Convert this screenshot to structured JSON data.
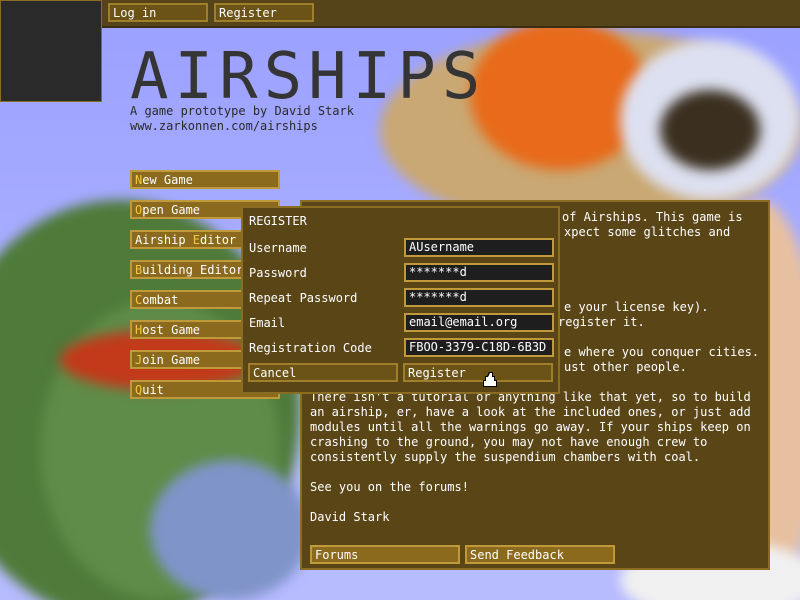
{
  "topbar": {
    "login": "Log in",
    "register": "Register"
  },
  "header": {
    "title": "AIRSHIPS",
    "subtitle": "A game prototype by David Stark",
    "url": "www.zarkonnen.com/airships"
  },
  "menu": [
    {
      "hotkey": "N",
      "rest": "ew Game"
    },
    {
      "hotkey": "O",
      "rest": "pen Game"
    },
    {
      "pre": "Airship ",
      "hotkey": "E",
      "rest": "ditor"
    },
    {
      "hotkey": "B",
      "rest": "uilding Editor"
    },
    {
      "hotkey": "C",
      "rest": "ombat"
    },
    {
      "hotkey": "H",
      "rest": "ost Game"
    },
    {
      "hotkey": "J",
      "rest": "oin Game"
    },
    {
      "hotkey": "Q",
      "rest": "uit"
    }
  ],
  "info": {
    "line1": "of Airships. This game is",
    "line2": "xpect some glitches and",
    "line3": "e your license key).",
    "line4": "register it.",
    "line5": "e where you conquer cities.",
    "line6": "ust other people.",
    "para": "There isn't a tutorial or anything like that yet, so to build\nan airship, er, have a look at the included ones, or just add\nmodules until all the warnings go away. If your ships keep on\ncrashing to the ground, you may not have enough crew to\nconsistently supply the suspendium chambers with coal.",
    "forums_line": "See you on the forums!",
    "signature": "David Stark",
    "forums_button": "Forums",
    "feedback_button": "Send Feedback"
  },
  "register_dialog": {
    "title": "REGISTER",
    "username_label": "Username",
    "username_value": "AUsername",
    "password_label": "Password",
    "password_value": "*******d",
    "repeat_label": "Repeat Password",
    "repeat_value": "*******d",
    "email_label": "Email",
    "email_value": "email@email.org",
    "code_label": "Registration Code",
    "code_value": "FBOO-3379-C18D-6B3D",
    "cancel": "Cancel",
    "register": "Register"
  },
  "colors": {
    "panel": "#5a4517",
    "button": "#8b6a1e",
    "border": "#c09a3a",
    "hotkey": "#f5c542",
    "sky": "#9aa0ff"
  }
}
